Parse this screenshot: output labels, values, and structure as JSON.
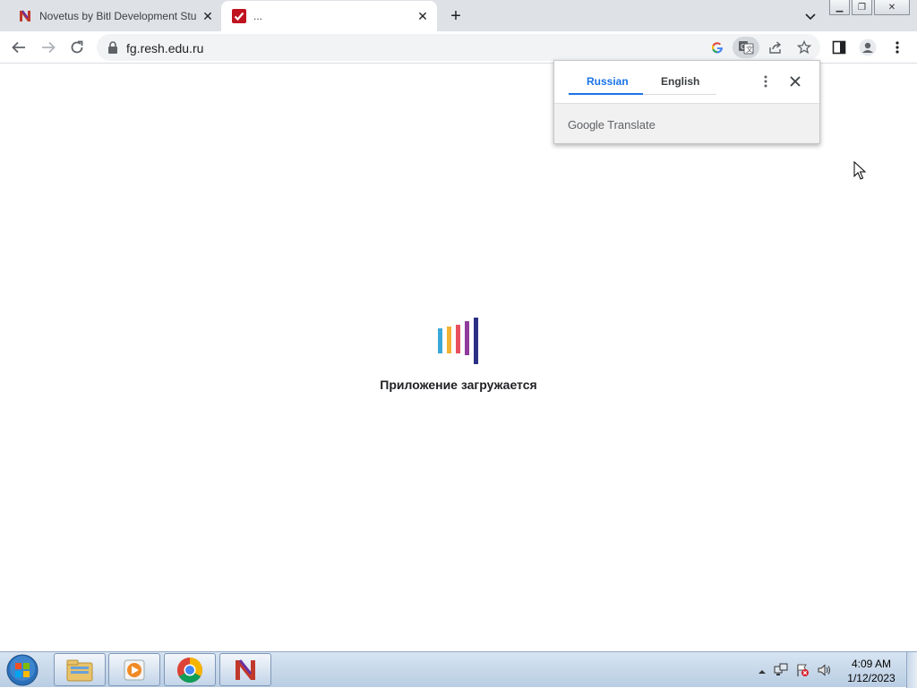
{
  "tabs": [
    {
      "title": "Novetus by Bitl Development Stu",
      "favicon": "novetus-n-icon",
      "active": false
    },
    {
      "title": "...",
      "favicon": "red-check-icon",
      "active": true
    }
  ],
  "address_bar": {
    "url": "fg.resh.edu.ru"
  },
  "translate_popup": {
    "source_language": "Russian",
    "target_language": "English",
    "footer_google": "Google",
    "footer_translate": "Translate"
  },
  "page": {
    "loading_text": "Приложение загружается",
    "loader_bar_colors": [
      "#3aa8d8",
      "#f2b233",
      "#e8505b",
      "#8e3b9c",
      "#2a2f84"
    ]
  },
  "taskbar": {
    "time": "4:09 AM",
    "date": "1/12/2023",
    "pinned": [
      "windows-explorer-icon",
      "media-player-icon",
      "chrome-icon",
      "novetus-icon"
    ]
  },
  "colors": {
    "accent": "#1a73e8",
    "tabstrip": "#dee1e6"
  }
}
